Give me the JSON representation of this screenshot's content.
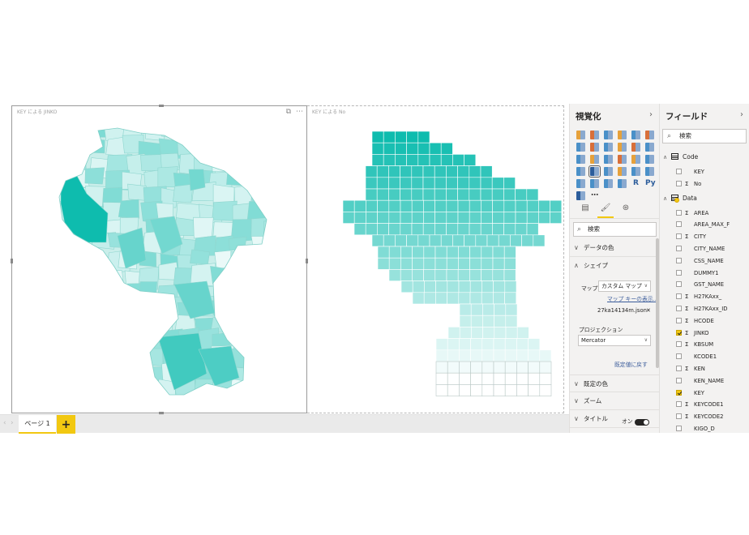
{
  "canvas": {
    "visual_left": {
      "title": "KEY による JINKO"
    },
    "visual_right": {
      "title": "KEY による No"
    },
    "visual_header": {
      "focus_icon": "focus-mode-icon",
      "more_icon": "more-options-icon",
      "more_glyph": "⋯"
    }
  },
  "pages": {
    "tabs": [
      {
        "label": "ページ 1"
      }
    ],
    "add_label": "+"
  },
  "viz_pane": {
    "title": "視覚化",
    "chevron": "›",
    "search_placeholder": "検索",
    "sections": {
      "data_colors": "データの色",
      "shape": "シェイプ",
      "default_color": "既定の色",
      "zoom": "ズーム",
      "title": "タイトル"
    },
    "shape": {
      "map_label": "マップ",
      "map_value": "カスタム マップ",
      "map_key_link": "マップ キーの表示...",
      "file_name": "27ka14134m.json",
      "remove_glyph": "✕",
      "projection_label": "プロジェクション",
      "projection_value": "Mercator",
      "reset_link": "既定値に戻す"
    },
    "title_toggle_label": "オン",
    "r_visual": "R",
    "py_visual": "Py",
    "more_visuals": "⋯"
  },
  "fields_pane": {
    "title": "フィールド",
    "chevron": "›",
    "search_placeholder": "検索",
    "tables": [
      {
        "name": "Code",
        "fields": [
          {
            "name": "KEY",
            "sum": false,
            "checked": false
          },
          {
            "name": "No",
            "sum": true,
            "checked": false
          }
        ]
      },
      {
        "name": "Data",
        "fields": [
          {
            "name": "AREA",
            "sum": true,
            "checked": false
          },
          {
            "name": "AREA_MAX_F",
            "sum": false,
            "checked": false
          },
          {
            "name": "CITY",
            "sum": true,
            "checked": false
          },
          {
            "name": "CITY_NAME",
            "sum": false,
            "checked": false
          },
          {
            "name": "CSS_NAME",
            "sum": false,
            "checked": false
          },
          {
            "name": "DUMMY1",
            "sum": false,
            "checked": false
          },
          {
            "name": "GST_NAME",
            "sum": false,
            "checked": false
          },
          {
            "name": "H27KAxx_",
            "sum": true,
            "checked": false
          },
          {
            "name": "H27KAxx_ID",
            "sum": true,
            "checked": false
          },
          {
            "name": "HCODE",
            "sum": true,
            "checked": false
          },
          {
            "name": "JINKO",
            "sum": true,
            "checked": true
          },
          {
            "name": "KBSUM",
            "sum": true,
            "checked": false
          },
          {
            "name": "KCODE1",
            "sum": false,
            "checked": false
          },
          {
            "name": "KEN",
            "sum": true,
            "checked": false
          },
          {
            "name": "KEN_NAME",
            "sum": false,
            "checked": false
          },
          {
            "name": "KEY",
            "sum": false,
            "checked": true
          },
          {
            "name": "KEYCODE1",
            "sum": true,
            "checked": false
          },
          {
            "name": "KEYCODE2",
            "sum": true,
            "checked": false
          },
          {
            "name": "KIGO_D",
            "sum": false,
            "checked": false
          }
        ]
      }
    ]
  },
  "colors": {
    "accent": "#f2c811",
    "map_high": "#01b8aa",
    "map_low": "#ffffff",
    "link": "#3a5b9a"
  }
}
